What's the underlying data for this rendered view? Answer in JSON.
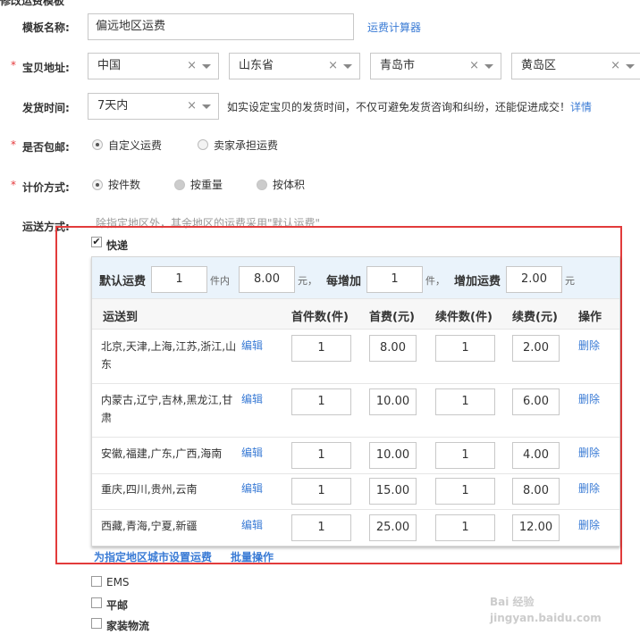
{
  "form": {
    "template_name_label": "模板名称:",
    "template_name_value": "偏远地区运费",
    "calc_link": "运费计算器",
    "address_label": "宝贝地址:",
    "required_mark": "*",
    "address": {
      "country": "中国",
      "province": "山东省",
      "city": "青岛市",
      "district": "黄岛区"
    },
    "clear_mark": "×",
    "ship_time_label": "发货时间:",
    "ship_time_value": "7天内",
    "ship_time_tip": "如实设定宝贝的发货时间，不仅可避免发货咨询和纠纷，还能促进成交！",
    "ship_time_detail": "详情",
    "free_ship_label": "是否包邮:",
    "free_ship_options": [
      "自定义运费",
      "卖家承担运费"
    ],
    "calc_method_label": "计价方式:",
    "calc_method_options": [
      "按件数",
      "按重量",
      "按体积"
    ],
    "ship_mode_label": "运送方式:",
    "ship_mode_tip": "除指定地区外，其余地区的运费采用\"默认运费\""
  },
  "express": {
    "label": "快递",
    "default": {
      "label": "默认运费",
      "first_qty": "1",
      "unit1": "件内",
      "first_fee": "8.00",
      "unit2": "元，",
      "each_add_label": "每增加",
      "add_qty": "1",
      "unit3": "件，",
      "add_fee_label": "增加运费",
      "add_fee": "2.00",
      "unit4": "元"
    },
    "headers": [
      "运送到",
      "首件数(件)",
      "首费(元)",
      "续件数(件)",
      "续费(元)",
      "操作"
    ],
    "edit_label": "编辑",
    "delete_label": "删除",
    "rows": [
      {
        "region1": "北京,天津,上海,江苏,浙江,山",
        "region2": "东",
        "first_qty": "1",
        "first_fee": "8.00",
        "add_qty": "1",
        "add_fee": "2.00"
      },
      {
        "region1": "内蒙古,辽宁,吉林,黑龙江,甘",
        "region2": "肃",
        "first_qty": "1",
        "first_fee": "10.00",
        "add_qty": "1",
        "add_fee": "6.00"
      },
      {
        "region1": "安徽,福建,广东,广西,海南",
        "region2": "",
        "first_qty": "1",
        "first_fee": "10.00",
        "add_qty": "1",
        "add_fee": "4.00"
      },
      {
        "region1": "重庆,四川,贵州,云南",
        "region2": "",
        "first_qty": "1",
        "first_fee": "15.00",
        "add_qty": "1",
        "add_fee": "8.00"
      },
      {
        "region1": "西藏,青海,宁夏,新疆",
        "region2": "",
        "first_qty": "1",
        "first_fee": "25.00",
        "add_qty": "1",
        "add_fee": "12.00"
      }
    ],
    "footer_set_link": "为指定地区城市设置运费",
    "footer_batch_link": "批量操作"
  },
  "other_methods": [
    "EMS",
    "平邮",
    "家装物流"
  ],
  "watermark": "Bai 经验 jingyan.baidu.com"
}
